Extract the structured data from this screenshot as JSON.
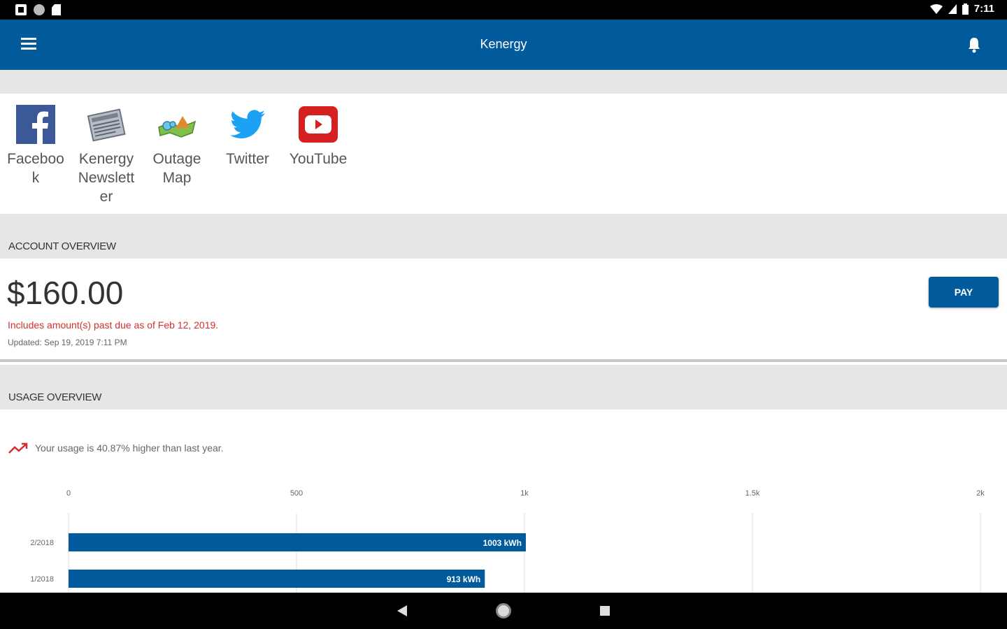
{
  "status_bar": {
    "time": "7:11"
  },
  "app_bar": {
    "title": "Kenergy"
  },
  "links": [
    {
      "label": "Facebook",
      "icon": "facebook-icon"
    },
    {
      "label": "Kenergy Newsletter",
      "icon": "newspaper-icon"
    },
    {
      "label": "Outage Map",
      "icon": "map-icon"
    },
    {
      "label": "Twitter",
      "icon": "twitter-icon"
    },
    {
      "label": "YouTube",
      "icon": "youtube-icon"
    }
  ],
  "account": {
    "header": "ACCOUNT OVERVIEW",
    "amount": "$160.00",
    "past_due": "Includes amount(s) past due as of Feb 12, 2019.",
    "updated": "Updated:  Sep 19, 2019 7:11 PM",
    "pay_label": "PAY"
  },
  "usage": {
    "header": "USAGE OVERVIEW",
    "trend_text": "Your usage is 40.87% higher than last year."
  },
  "colors": {
    "brand": "#005a9c",
    "alert": "#d32f2f"
  },
  "chart_data": {
    "type": "bar",
    "orientation": "horizontal",
    "xlim": [
      0,
      2000
    ],
    "ticks": [
      0,
      500,
      1000,
      1500,
      2000
    ],
    "tick_labels": [
      "0",
      "500",
      "1k",
      "1.5k",
      "2k"
    ],
    "categories": [
      "2/2018",
      "1/2018"
    ],
    "values": [
      1003,
      913
    ],
    "value_labels": [
      "1003 kWh",
      "913 kWh"
    ],
    "grid": true,
    "color": "#005a9c"
  }
}
